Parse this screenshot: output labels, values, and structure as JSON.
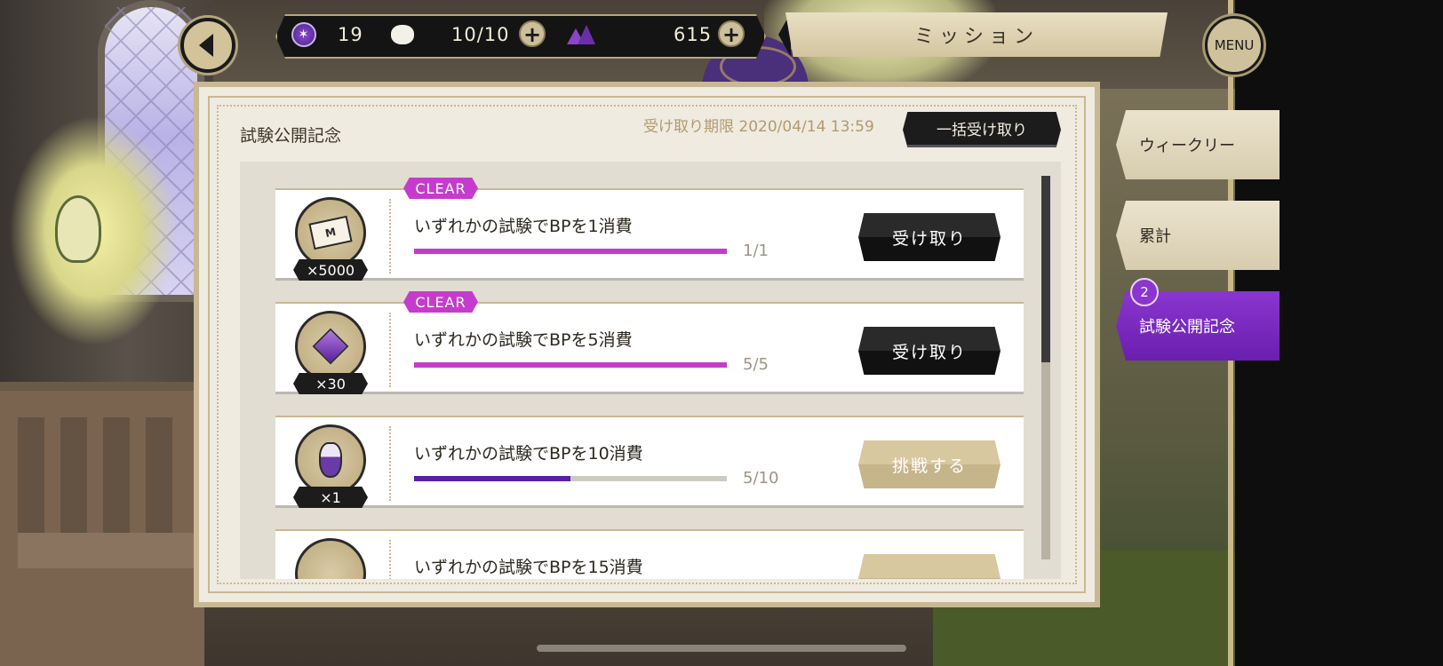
{
  "header": {
    "gem_count": "19",
    "stamina": "10/10",
    "crystal_count": "615",
    "title": "ミッション",
    "menu_label": "MENU"
  },
  "panel": {
    "title": "試験公開記念",
    "deadline": "受け取り期限 2020/04/14 13:59",
    "bulk_receive_label": "一括受け取り"
  },
  "missions": [
    {
      "clear_tag": "CLEAR",
      "reward_count": "×5000",
      "title": "いずれかの試験でBPを1消費",
      "progress": "1/1",
      "progress_fraction": 1.0,
      "bar_color": "#c53ccc",
      "button_label": "受け取り",
      "button_type": "receive",
      "icon": "madol-money-icon"
    },
    {
      "clear_tag": "CLEAR",
      "reward_count": "×30",
      "title": "いずれかの試験でBPを5消費",
      "progress": "5/5",
      "progress_fraction": 1.0,
      "bar_color": "#c53ccc",
      "button_label": "受け取り",
      "button_type": "receive",
      "icon": "magic-crystal-icon"
    },
    {
      "clear_tag": "",
      "reward_count": "×1",
      "title": "いずれかの試験でBPを10消費",
      "progress": "5/10",
      "progress_fraction": 0.5,
      "bar_color": "#5a1fa8",
      "button_label": "挑戦する",
      "button_type": "challenge",
      "icon": "potion-icon"
    },
    {
      "clear_tag": "",
      "reward_count": "",
      "title": "いずれかの試験でBPを15消費",
      "progress": "",
      "progress_fraction": 0.0,
      "bar_color": "#5a1fa8",
      "button_label": "",
      "button_type": "challenge",
      "icon": "reward-icon"
    }
  ],
  "tabs": [
    {
      "label": "ウィークリー",
      "active": false
    },
    {
      "label": "累計",
      "active": false
    },
    {
      "label": "試験公開記念",
      "active": true,
      "badge": "2"
    }
  ],
  "colors": {
    "accent_purple": "#8a35d0",
    "clear_pink": "#c53ccc",
    "panel_bg": "#efebe0",
    "gold_border": "#c8b994"
  }
}
